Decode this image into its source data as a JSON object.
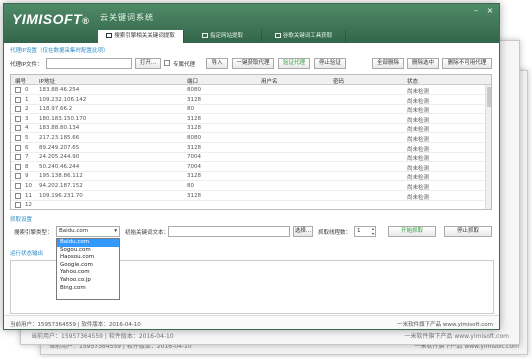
{
  "app": {
    "logo": "YIMISOFT",
    "logo_tm": "®",
    "title": "云关键词系统"
  },
  "tabs": [
    {
      "label": "搜索引擎相关关键词提取",
      "active": true
    },
    {
      "label": "指定网站提取",
      "active": false
    },
    {
      "label": "谷歌关键词工具获取",
      "active": false
    }
  ],
  "proxy": {
    "section": "代理IP设置（仅在数据采集时配置此项）",
    "file_label": "代理IP文件：",
    "file_value": "",
    "open_btn": "打开...",
    "exclusive_label": "专属代理",
    "import_btn": "导入",
    "auto_get_btn": "一键获取代理",
    "verify_btn": "验证代理",
    "stop_verify_btn": "停止验证",
    "delete_all_btn": "全部删除",
    "delete_selected_btn": "删除选中",
    "delete_unusable_btn": "删除不可用代理"
  },
  "table": {
    "headers": {
      "no": "编号",
      "ip": "IP地址",
      "port": "端口",
      "user": "用户名",
      "password": "密码",
      "status": "状态"
    },
    "rows": [
      {
        "no": "0",
        "ip": "183.88.46.254",
        "port": "8080",
        "status": "尚未检测"
      },
      {
        "no": "1",
        "ip": "109.232.106.142",
        "port": "3128",
        "status": "尚未检测"
      },
      {
        "no": "2",
        "ip": "118.97.66.2",
        "port": "80",
        "status": "尚未检测"
      },
      {
        "no": "3",
        "ip": "180.183.150.170",
        "port": "3128",
        "status": "尚未检测"
      },
      {
        "no": "4",
        "ip": "183.88.80.134",
        "port": "3128",
        "status": "尚未检测"
      },
      {
        "no": "5",
        "ip": "217.23.185.66",
        "port": "8080",
        "status": "尚未检测"
      },
      {
        "no": "6",
        "ip": "89.249.207.65",
        "port": "3128",
        "status": "尚未检测"
      },
      {
        "no": "7",
        "ip": "24.205.244.90",
        "port": "7004",
        "status": "尚未检测"
      },
      {
        "no": "8",
        "ip": "50.240.46.244",
        "port": "7004",
        "status": "尚未检测"
      },
      {
        "no": "9",
        "ip": "195.138.86.112",
        "port": "3128",
        "status": "尚未检测"
      },
      {
        "no": "10",
        "ip": "94.202.187.152",
        "port": "80",
        "status": "尚未检测"
      },
      {
        "no": "11",
        "ip": "109.196.231.70",
        "port": "3128",
        "status": "尚未检测"
      },
      {
        "no": "12",
        "ip": "",
        "port": "",
        "status": ""
      }
    ]
  },
  "crawl": {
    "section": "抓取设置",
    "engine_label": "搜索引擎类型：",
    "engine_value": "Baidu.com",
    "keyword_label": "初始关键词文本：",
    "keyword_value": "",
    "choose_btn": "选择...",
    "threads_label": "抓取线程数：",
    "threads_value": "1",
    "start_btn": "开始抓取",
    "stop_btn": "停止抓取",
    "engine_options": [
      "Baidu.com",
      "Sogou.com",
      "Haosou.com",
      "Google.com",
      "Yahoo.com",
      "Yahoo.co.jp",
      "Bing.com"
    ]
  },
  "log": {
    "section": "运行状态输出"
  },
  "status": {
    "user": "当前用户：15957364559 | 软件版本：2016-04-10",
    "vendor": "一米软件旗下产品 www.yimisoft.com"
  },
  "colors": {
    "titlebar": "#3b7355",
    "accent": "#2e8bc6",
    "green": "#2f9a35",
    "selected": "#3399ff"
  }
}
